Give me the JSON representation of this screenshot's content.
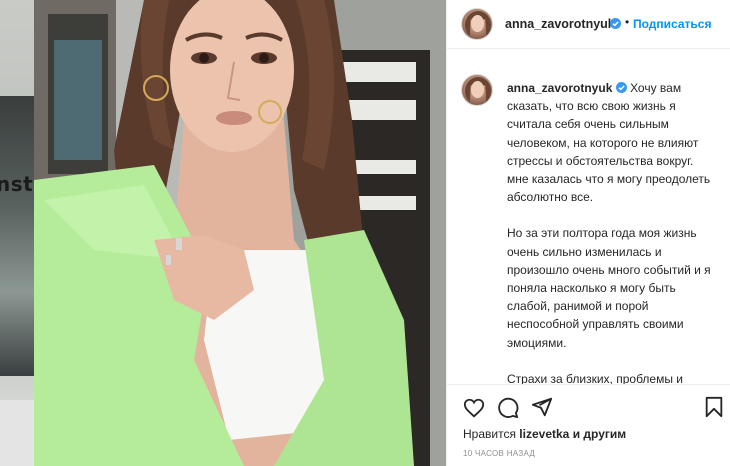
{
  "prev_post": {
    "overlay_text": "nsta"
  },
  "post": {
    "author": {
      "username": "anna_zavorotnyuk",
      "verified": true,
      "verified_icon": "verified-badge-icon",
      "follow_label": "Подписаться",
      "more_label": "..."
    },
    "caption": {
      "username": "anna_zavorotnyuk",
      "paragraphs": [
        "Хочу вам сказать, что всю свою жизнь я считала себя очень сильным человеком, на которого не влияют стрессы и обстоятельства вокруг. мне казалась что я могу преодолеть абсолютно все.",
        "Но за эти полтора года моя жизнь очень сильно изменилась и произошло очень много событий и я поняла насколько я могу быть слабой, ранимой и порой неспособной управлять своими эмоциями.",
        "Страхи за близких, проблемы и стрессовые ситуации есть у каждого из нас и это нормально, что мы чего-то боимся. Но мы должны"
      ]
    },
    "actions": {
      "like_icon": "heart-icon",
      "comment_icon": "comment-icon",
      "share_icon": "paper-plane-icon",
      "save_icon": "bookmark-icon"
    },
    "likes": {
      "prefix": "Нравится",
      "user": "lizevetka",
      "suffix": "и другим"
    },
    "timestamp": "10 ЧАСОВ НАЗАД"
  },
  "colors": {
    "link_blue": "#0095f6",
    "verified_blue": "#3897f0",
    "sweater_green": "#b5ec9a",
    "text_primary": "#262626",
    "text_secondary": "#8e8e8e"
  }
}
